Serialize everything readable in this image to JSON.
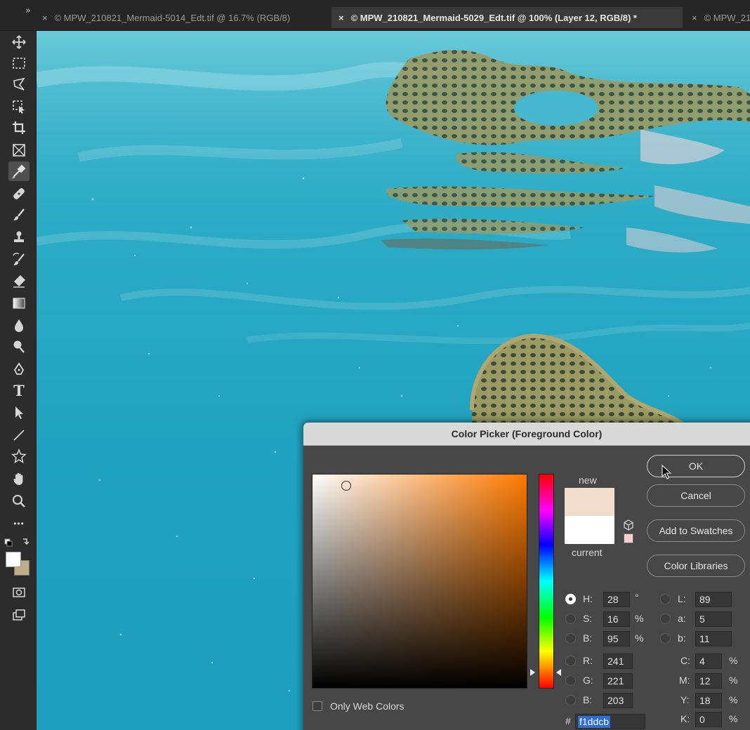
{
  "tabs": [
    {
      "close": "×",
      "label": "© MPW_210821_Mermaid-5014_Edt.tif @ 16.7% (RGB/8)",
      "active": false
    },
    {
      "close": "×",
      "label": "© MPW_210821_Mermaid-5029_Edt.tif @ 100% (Layer 12, RGB/8) *",
      "active": true
    },
    {
      "close": "×",
      "label": "© MPW_21",
      "active": false
    }
  ],
  "panel_collapse": "»",
  "toolbar": {
    "tools": [
      "move-tool",
      "marquee-tool",
      "lasso-tool",
      "object-selection-tool",
      "crop-tool",
      "frame-tool",
      "eyedropper-tool",
      "healing-brush-tool",
      "brush-tool",
      "clone-stamp-tool",
      "history-brush-tool",
      "eraser-tool",
      "gradient-tool",
      "blur-tool",
      "dodge-tool",
      "pen-tool",
      "type-tool",
      "path-selection-tool",
      "line-tool",
      "custom-shape-tool",
      "hand-tool",
      "zoom-tool",
      "more-tools"
    ],
    "selected_tool": "eyedropper-tool",
    "type_tool_glyph": "T",
    "more_glyph": "•••",
    "foreground_color": "#ffffff",
    "background_color": "#bfae86"
  },
  "dialog": {
    "title": "Color Picker (Foreground Color)",
    "new_label": "new",
    "current_label": "current",
    "new_color": "#f1ddcb",
    "current_color": "#ffffff",
    "buttons": {
      "ok": "OK",
      "cancel": "Cancel",
      "add_to_swatches": "Add to Swatches",
      "color_libraries": "Color Libraries"
    },
    "hsb": {
      "h_label": "H:",
      "h": "28",
      "h_unit": "°",
      "s_label": "S:",
      "s": "16",
      "s_unit": "%",
      "b_label": "B:",
      "b": "95",
      "b_unit": "%"
    },
    "rgb": {
      "r_label": "R:",
      "r": "241",
      "g_label": "G:",
      "g": "221",
      "b_label": "B:",
      "b": "203"
    },
    "lab": {
      "l_label": "L:",
      "l": "89",
      "a_label": "a:",
      "a": "5",
      "b_label": "b:",
      "b": "11"
    },
    "cmyk": {
      "c_label": "C:",
      "c": "4",
      "c_unit": "%",
      "m_label": "M:",
      "m": "12",
      "m_unit": "%",
      "y_label": "Y:",
      "y": "18",
      "y_unit": "%",
      "k_label": "K:",
      "k": "0",
      "k_unit": "%"
    },
    "hex_label": "#",
    "hex": "f1ddcb",
    "only_web_colors": "Only Web Colors",
    "selected_mode": "H"
  }
}
